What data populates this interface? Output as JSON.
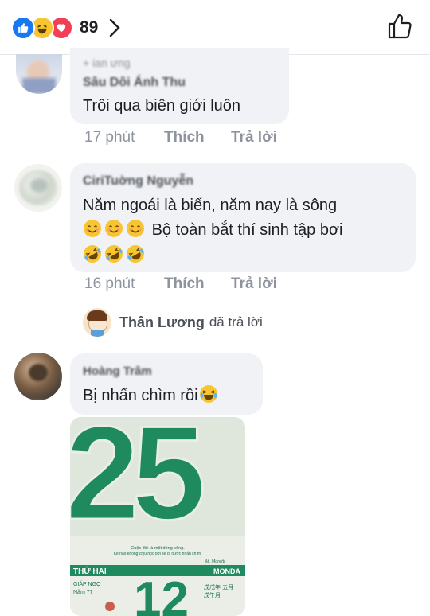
{
  "header": {
    "reaction_count": "89",
    "reactions": [
      "like-icon",
      "haha-icon",
      "love-icon"
    ]
  },
  "comments": [
    {
      "tag": "+ ian ưng",
      "author": "Sâu Dôi Ánh Thu",
      "text": "Trôi qua biên giới luôn",
      "time": "17 phút",
      "like": "Thích",
      "reply": "Trả lời"
    },
    {
      "author": "CiriTuờng Nguyễn",
      "line1": "Năm ngoái là biển, năm nay là sông",
      "line2": "Bộ toàn bắt thí sinh tập bơi",
      "time": "16 phút",
      "like": "Thích",
      "reply": "Trả lời"
    },
    {
      "author": "Hoàng Trâm",
      "text": "Bị nhấn chìm rồi"
    }
  ],
  "replied": {
    "name": "Thân Lương",
    "suffix": "đã trả lời"
  },
  "photo": {
    "number": "25",
    "quote_line1": "Cuộc đời là một dòng sông.",
    "quote_line2": "Kẻ nào không chịu học bơi sẽ bị nước nhấn chìm.",
    "author": "M. Moretti",
    "weekday": "THỨ HAI",
    "weekday_right": "MONDA",
    "small_number": "12",
    "lunar_left1": "GIÁP NGỌ",
    "lunar_left2": "Năm 77",
    "lunar_right1": "戊戌年  五月",
    "lunar_right2": "戊午月"
  },
  "colors": {
    "accent": "#1877f2",
    "calendar_green": "#1f8a5e",
    "bubble": "#f0f2f5",
    "meta": "#8d949e"
  }
}
